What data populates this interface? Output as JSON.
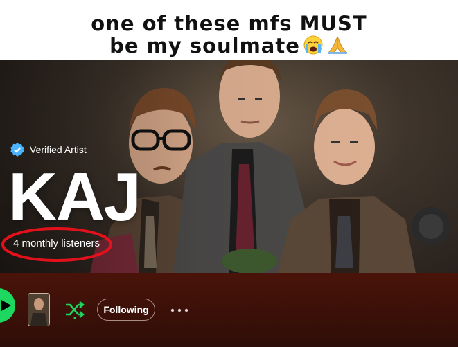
{
  "caption": {
    "line1": "one of these mfs MUST",
    "line2": "be my soulmate",
    "emojis": [
      "loudly-crying-face",
      "folded-hands"
    ]
  },
  "artist": {
    "verified_label": "Verified Artist",
    "name": "KAJ",
    "monthly_listeners": "4 monthly listeners"
  },
  "actions": {
    "following_label": "Following",
    "more_label": "···"
  },
  "icons": [
    "verified-badge-icon",
    "play-icon",
    "shuffle-icon",
    "more-options-icon"
  ],
  "colors": {
    "spotify_green": "#1ed760",
    "verified_blue": "#4cb3ff",
    "annotation_red": "#e3111b",
    "action_bar": "#3a0f08"
  }
}
